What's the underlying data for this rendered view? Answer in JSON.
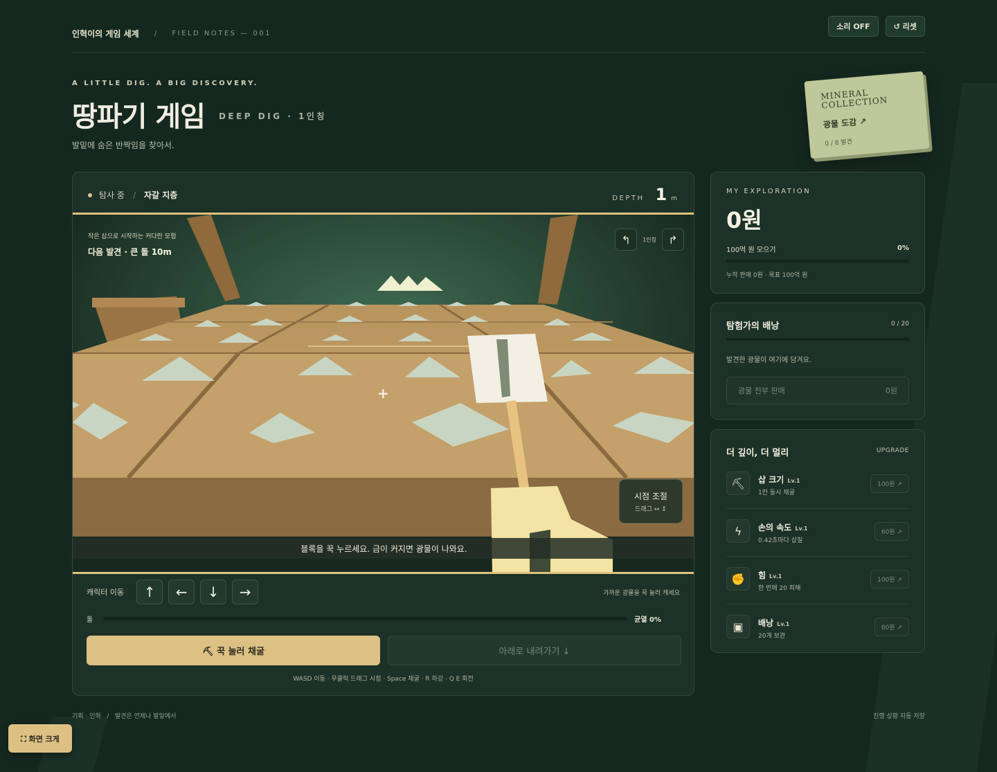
{
  "header": {
    "brand": "인혁이의 게임 세계",
    "separator": "/",
    "notes": "FIELD NOTES — 001",
    "sound_button": "소리 OFF",
    "reset_button": "↺ 리셋"
  },
  "hero": {
    "tagline": "A LITTLE DIG. A BIG DISCOVERY.",
    "title": "땅파기 게임",
    "subtitle": "DEEP DIG · 1인칭",
    "description": "발밑에 숨은 반짝임을 찾아서."
  },
  "mineral_card": {
    "title_line1": "MINERAL",
    "title_line2": "COLLECTION",
    "link": "광물 도감 ↗",
    "count": "0 / 8 발견"
  },
  "game": {
    "status_exploring": "탐사 중",
    "status_layer": "자갈 지층",
    "depth_label": "DEPTH",
    "depth_value": "1",
    "depth_unit": "m",
    "viewport": {
      "intro": "작은 삽으로 시작하는 커다란 모험",
      "next_goal": "다음 발견 · 큰 돌 10m",
      "view_label": "1인칭",
      "crosshair": "+",
      "view_adjust_title": "시점 조절",
      "view_adjust_sub": "드래그 ↔ ↕",
      "hint": "블록을 꾹 누르세요. 금이 커지면 광물이 나와요."
    },
    "controls": {
      "move_label": "캐릭터 이동",
      "arrows": [
        "↑",
        "←",
        "↓",
        "→"
      ],
      "move_hint": "가까운 광물을 꾹 눌러 캐세요",
      "block_label": "돌",
      "crack_label": "균열 0%",
      "crack_progress": 0,
      "dig_button": "⛏ 꾹 눌러 채굴",
      "down_button": "아래로 내려가기 ↓",
      "key_hint": "WASD 이동 · 우클릭 드래그 시점 · Space 채굴 · R 하강 · Q E 회전"
    }
  },
  "exploration": {
    "label": "MY EXPLORATION",
    "money": "0원",
    "goal": "100억 원 모으기",
    "percent": "0%",
    "progress": 0,
    "sub": "누적 판매 0원 · 목표 100억 원"
  },
  "bag": {
    "title": "탐험가의 배낭",
    "count": "0 / 20",
    "progress": 0,
    "desc": "발견한 광물이 여기에 담겨요.",
    "sell_label": "광물 전부 판매",
    "sell_value": "0원"
  },
  "upgrades": {
    "title": "더 깊이, 더 멀리",
    "tag": "UPGRADE",
    "items": [
      {
        "icon": "pickaxe-icon",
        "glyph": "⛏",
        "name": "삽 크기",
        "level": "Lv.1",
        "desc": "1칸 동시 채굴",
        "price": "100원 ↗"
      },
      {
        "icon": "lightning-icon",
        "glyph": "ϟ",
        "name": "손의 속도",
        "level": "Lv.1",
        "desc": "0.42초마다 삽질",
        "price": "60원 ↗"
      },
      {
        "icon": "fist-icon",
        "glyph": "✊",
        "name": "힘",
        "level": "Lv.1",
        "desc": "한 번에 20 피해",
        "price": "100원 ↗"
      },
      {
        "icon": "backpack-icon",
        "glyph": "▣",
        "name": "배낭",
        "level": "Lv.1",
        "desc": "20개 보관",
        "price": "80원 ↗"
      }
    ]
  },
  "footer": {
    "left": "기획 · 인혁   /   발견은 언제나 발밑에서",
    "right": "진행 상황 자동 저장",
    "fullscreen": "⛶ 화면 크게"
  },
  "colors": {
    "background": "#15281f",
    "panel": "#1c3127",
    "accent": "#dcc084"
  }
}
